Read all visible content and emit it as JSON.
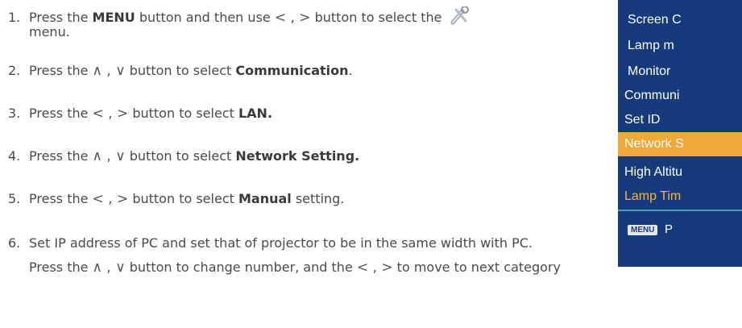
{
  "steps": [
    {
      "num": "1.",
      "pre": "Press the ",
      "bold": "MENU",
      "mid": " button and then use ",
      "arrows": "< , >",
      "post": " button to select the ",
      "icon": "tools-icon",
      "cont": "menu."
    },
    {
      "num": "2.",
      "pre": "Press the ",
      "arrows": "∧ , ∨",
      "mid": " button to select ",
      "bold": "Communication",
      "post": "."
    },
    {
      "num": "3.",
      "pre": "Press the ",
      "arrows": "< , >",
      "mid": " button to select ",
      "bold": "LAN.",
      "post": ""
    },
    {
      "num": "4.",
      "pre": "Press the ",
      "arrows": "∧ , ∨",
      "mid": " button to select ",
      "bold": "Network Setting.",
      "post": ""
    },
    {
      "num": "5.",
      "pre": "Press the ",
      "arrows": "< , >",
      "mid": " button to select ",
      "bold": "Manual",
      "post": " setting."
    },
    {
      "num": "6.",
      "text": "Set IP address of PC and set that of projector to be in the same width with PC.",
      "cont_pre": "Press the ",
      "cont_arrows1": "∧ , ∨",
      "cont_mid": " button to change number, and the ",
      "cont_arrows2": "< , >",
      "cont_post": " to move to next category"
    }
  ],
  "osd": {
    "items": [
      {
        "label": "Screen C",
        "style": "indent"
      },
      {
        "label": "Lamp m",
        "style": "indent"
      },
      {
        "label": "Monitor",
        "style": "indent"
      },
      {
        "label": "Communi",
        "style": "normal"
      },
      {
        "label": "Set ID",
        "style": "normal"
      },
      {
        "label": "Network S",
        "style": "selected"
      },
      {
        "label": "High Altitu",
        "style": "normal"
      },
      {
        "label": "Lamp Tim",
        "style": "amber"
      }
    ],
    "menu_key": "MENU",
    "hint": "P"
  },
  "colors": {
    "osd_bg": "#173a7c",
    "highlight": "#f0a83a",
    "amber_text": "#f5b63f",
    "separator": "#3fa7a7"
  }
}
